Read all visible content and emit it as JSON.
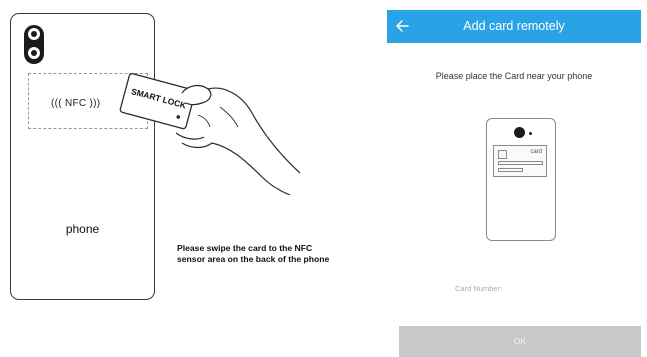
{
  "illustration": {
    "nfc_label": "((( NFC )))",
    "card_text": "SMART LOCK",
    "phone_label": "phone",
    "instruction_line1": "Please swipe the card to the NFC",
    "instruction_line2": "sensor area on the back of the phone"
  },
  "app": {
    "header": {
      "title": "Add card remotely",
      "back_icon": "arrow-left-icon",
      "color": "#29a3e6"
    },
    "prompt": "Please place the Card near your phone",
    "preview": {
      "card_label": "card"
    },
    "card_number_label": "Card Number:",
    "ok_button": {
      "label": "OK",
      "color": "#c8c8c8"
    }
  }
}
